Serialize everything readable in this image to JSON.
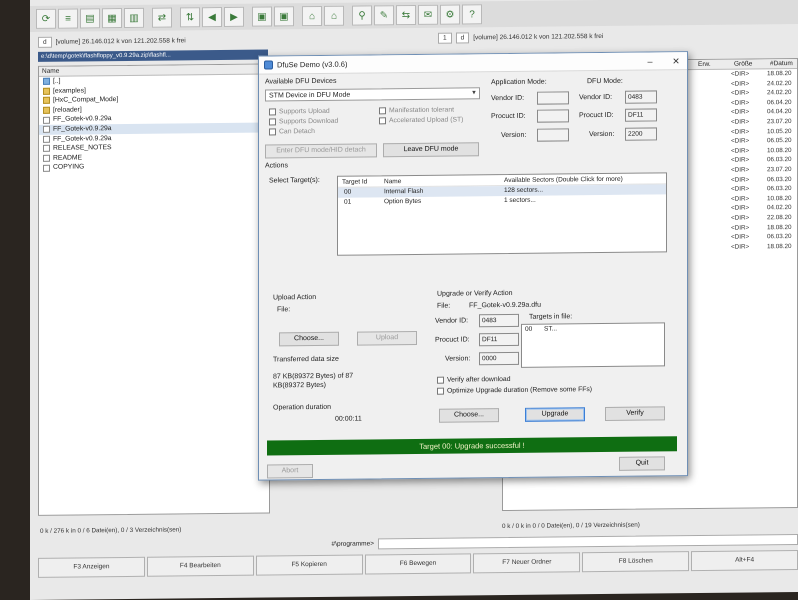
{
  "file_manager": {
    "left_drive": {
      "drive": "d",
      "info": "[volume]  26.146.012 k von 121.202.558 k frei"
    },
    "right_drive": {
      "page": "1",
      "drive": "d",
      "info": "[volume]  26.146.012 k von 121.202.558 k frei"
    },
    "path": "e:\\d\\temp\\gotek\\flashfloppy_v0.9.29a.zip\\flashfl...",
    "left_column": "Name",
    "left_items": [
      {
        "name": "[..]",
        "icon": "up-icon"
      },
      {
        "name": "[examples]",
        "icon": "folder-icon"
      },
      {
        "name": "[HxC_Compat_Mode]",
        "icon": "folder-icon"
      },
      {
        "name": "[reloader]",
        "icon": "folder-icon"
      },
      {
        "name": "FF_Gotek-v0.9.29a",
        "icon": "file-icon"
      },
      {
        "name": "FF_Gotek-v0.9.29a",
        "icon": "file-icon"
      },
      {
        "name": "FF_Gotek-v0.9.29a",
        "icon": "file-icon"
      },
      {
        "name": "RELEASE_NOTES",
        "icon": "file-icon"
      },
      {
        "name": "README",
        "icon": "file-icon"
      },
      {
        "name": "COPYING",
        "icon": "file-icon"
      }
    ],
    "right_columns": [
      "Erw.",
      "Größe",
      "#Datum"
    ],
    "right_rows": [
      {
        "size": "<DIR>",
        "date": "18.08.20"
      },
      {
        "size": "<DIR>",
        "date": "24.02.20"
      },
      {
        "size": "<DIR>",
        "date": "24.02.20"
      },
      {
        "size": "<DIR>",
        "date": "06.04.20"
      },
      {
        "size": "<DIR>",
        "date": "04.04.20"
      },
      {
        "size": "<DIR>",
        "date": "23.07.20"
      },
      {
        "size": "<DIR>",
        "date": "10.05.20"
      },
      {
        "size": "<DIR>",
        "date": "06.05.20"
      },
      {
        "size": "<DIR>",
        "date": "10.08.20"
      },
      {
        "size": "<DIR>",
        "date": "06.03.20"
      },
      {
        "size": "<DIR>",
        "date": "23.07.20"
      },
      {
        "size": "<DIR>",
        "date": "06.03.20"
      },
      {
        "size": "<DIR>",
        "date": "06.03.20"
      },
      {
        "size": "<DIR>",
        "date": "10.08.20"
      },
      {
        "size": "<DIR>",
        "date": "04.02.20"
      },
      {
        "size": "<DIR>",
        "date": "22.08.20"
      },
      {
        "size": "<DIR>",
        "date": "18.08.20"
      },
      {
        "size": "<DIR>",
        "date": "06.03.20"
      },
      {
        "size": "<DIR>",
        "date": "18.08.20"
      }
    ],
    "left_status": "0 k / 276 k in 0 / 6 Datei(en), 0 / 3 Verzeichnis(sen)",
    "right_status": "0 k / 0 k in 0 / 0 Datei(en), 0 / 19 Verzeichnis(sen)",
    "cmd_label": "#\\programme>",
    "fkeys": [
      "F3 Anzeigen",
      "F4 Bearbeiten",
      "F5 Kopieren",
      "F6 Bewegen",
      "F7 Neuer Ordner",
      "F8 Löschen",
      "Alt+F4"
    ]
  },
  "dialog": {
    "title": "DfuSe Demo (v3.0.6)",
    "minimize": "–",
    "close": "✕",
    "dfu_devices_label": "Available DFU Devices",
    "device_selected": "STM Device in DFU Mode",
    "supports_upload": "Supports Upload",
    "supports_download": "Supports Download",
    "can_detach": "Can Detach",
    "manifestation_tolerant": "Manifestation tolerant",
    "accelerated_upload": "Accelerated Upload (ST)",
    "enter_dfu_btn": "Enter DFU mode/HID detach",
    "leave_dfu_btn": "Leave DFU mode",
    "app_mode_label": "Application Mode:",
    "dfu_mode_label": "DFU Mode:",
    "vendor_id_label": "Vendor ID:",
    "procuct_id_label": "Procuct ID:",
    "version_label": "Version:",
    "dfu_vendor_id": "0483",
    "dfu_procuct_id": "DF11",
    "dfu_version": "2200",
    "actions_label": "Actions",
    "select_targets_label": "Select Target(s):",
    "targets_headers": [
      "Target Id",
      "Name",
      "Available Sectors (Double Click for more)"
    ],
    "targets": [
      {
        "id": "00",
        "name": "Internal Flash",
        "sectors": "128 sectors..."
      },
      {
        "id": "01",
        "name": "Option Bytes",
        "sectors": "1 sectors..."
      }
    ],
    "upload_action_label": "Upload Action",
    "upload_file_label": "File:",
    "choose_btn": "Choose...",
    "upload_btn": "Upload",
    "transferred_label": "Transferred data size",
    "transferred_value": "87 KB(89372 Bytes) of 87 KB(89372 Bytes)",
    "duration_label": "Operation duration",
    "duration_value": "00:00:11",
    "upgrade_label": "Upgrade or Verify Action",
    "file_label": "File:",
    "file_value": "FF_Gotek-v0.9.29a.dfu",
    "up_vendor_label": "Vendor ID:",
    "up_vendor_value": "0483",
    "up_procuct_label": "Procuct ID:",
    "up_procuct_value": "DF11",
    "up_version_label": "Version:",
    "up_version_value": "0000",
    "targets_in_file_label": "Targets in file:",
    "targets_in_file": [
      {
        "id": "00",
        "name": "ST..."
      }
    ],
    "verify_after_download": "Verify after download",
    "optimize_upgrade": "Optimize Upgrade duration (Remove some FFs)",
    "choose_btn2": "Choose...",
    "upgrade_btn": "Upgrade",
    "verify_btn": "Verify",
    "status_banner": "Target 00: Upgrade successful !",
    "abort_btn": "Abort",
    "quit_btn": "Quit"
  },
  "colors": {
    "banner_green": "#0f6e12",
    "selection": "#3b5a8a"
  }
}
